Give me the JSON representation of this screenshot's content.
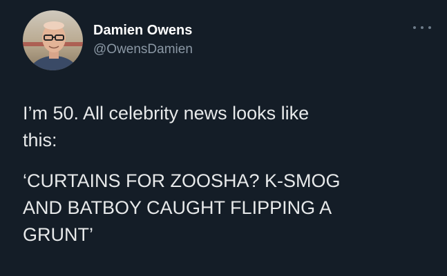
{
  "user": {
    "display_name": "Damien Owens",
    "handle": "@OwensDamien"
  },
  "tweet": {
    "paragraphs": [
      "I’m 50. All celebrity news looks like\nthis:",
      "‘CURTAINS FOR ZOOSHA? K-SMOG\nAND BATBOY CAUGHT FLIPPING A\nGRUNT’"
    ]
  },
  "icons": {
    "more": "more-horizontal-icon",
    "avatar": "avatar-photo"
  },
  "colors": {
    "background": "#141d27",
    "text_primary": "#ffffff",
    "text_body": "#e7e9ea",
    "text_secondary": "#8b98a5"
  }
}
